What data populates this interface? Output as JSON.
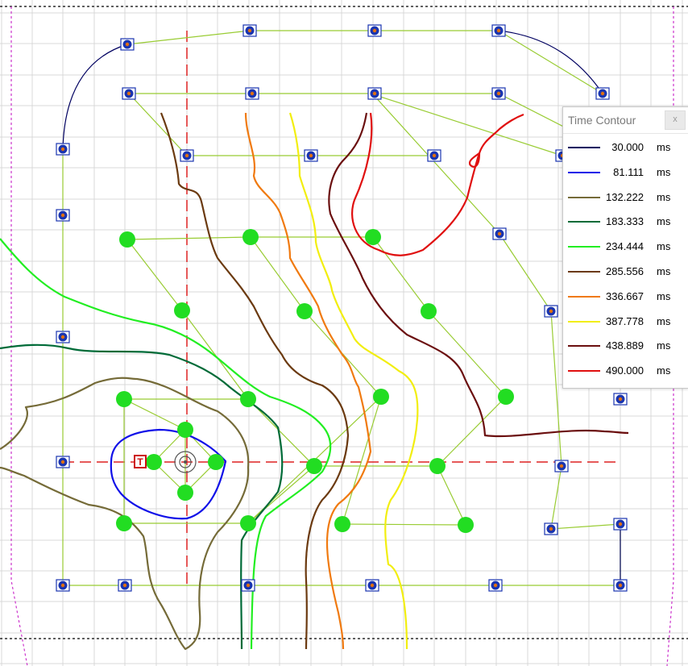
{
  "legend": {
    "title": "Time Contour",
    "close_label": "x",
    "unit": "ms",
    "entries": [
      {
        "value": "30.000",
        "color": "#000060"
      },
      {
        "value": "81.111",
        "color": "#1010e8"
      },
      {
        "value": "132.222",
        "color": "#756b38"
      },
      {
        "value": "183.333",
        "color": "#006b38"
      },
      {
        "value": "234.444",
        "color": "#22ee22"
      },
      {
        "value": "285.556",
        "color": "#6b3a10"
      },
      {
        "value": "336.667",
        "color": "#f07a10"
      },
      {
        "value": "387.778",
        "color": "#f2ee10"
      },
      {
        "value": "438.889",
        "color": "#6b0f0f"
      },
      {
        "value": "490.000",
        "color": "#e01010"
      }
    ]
  },
  "source_marker_label": "T",
  "colors": {
    "grid": "#d8d8d8",
    "outline": "#99cc33",
    "crosshair": "#dd2222",
    "boundary_dotted": "#000000",
    "side_dotted": "#cc33cc",
    "receiver_node": "#22dd22",
    "geophone": "#1a35b0"
  }
}
